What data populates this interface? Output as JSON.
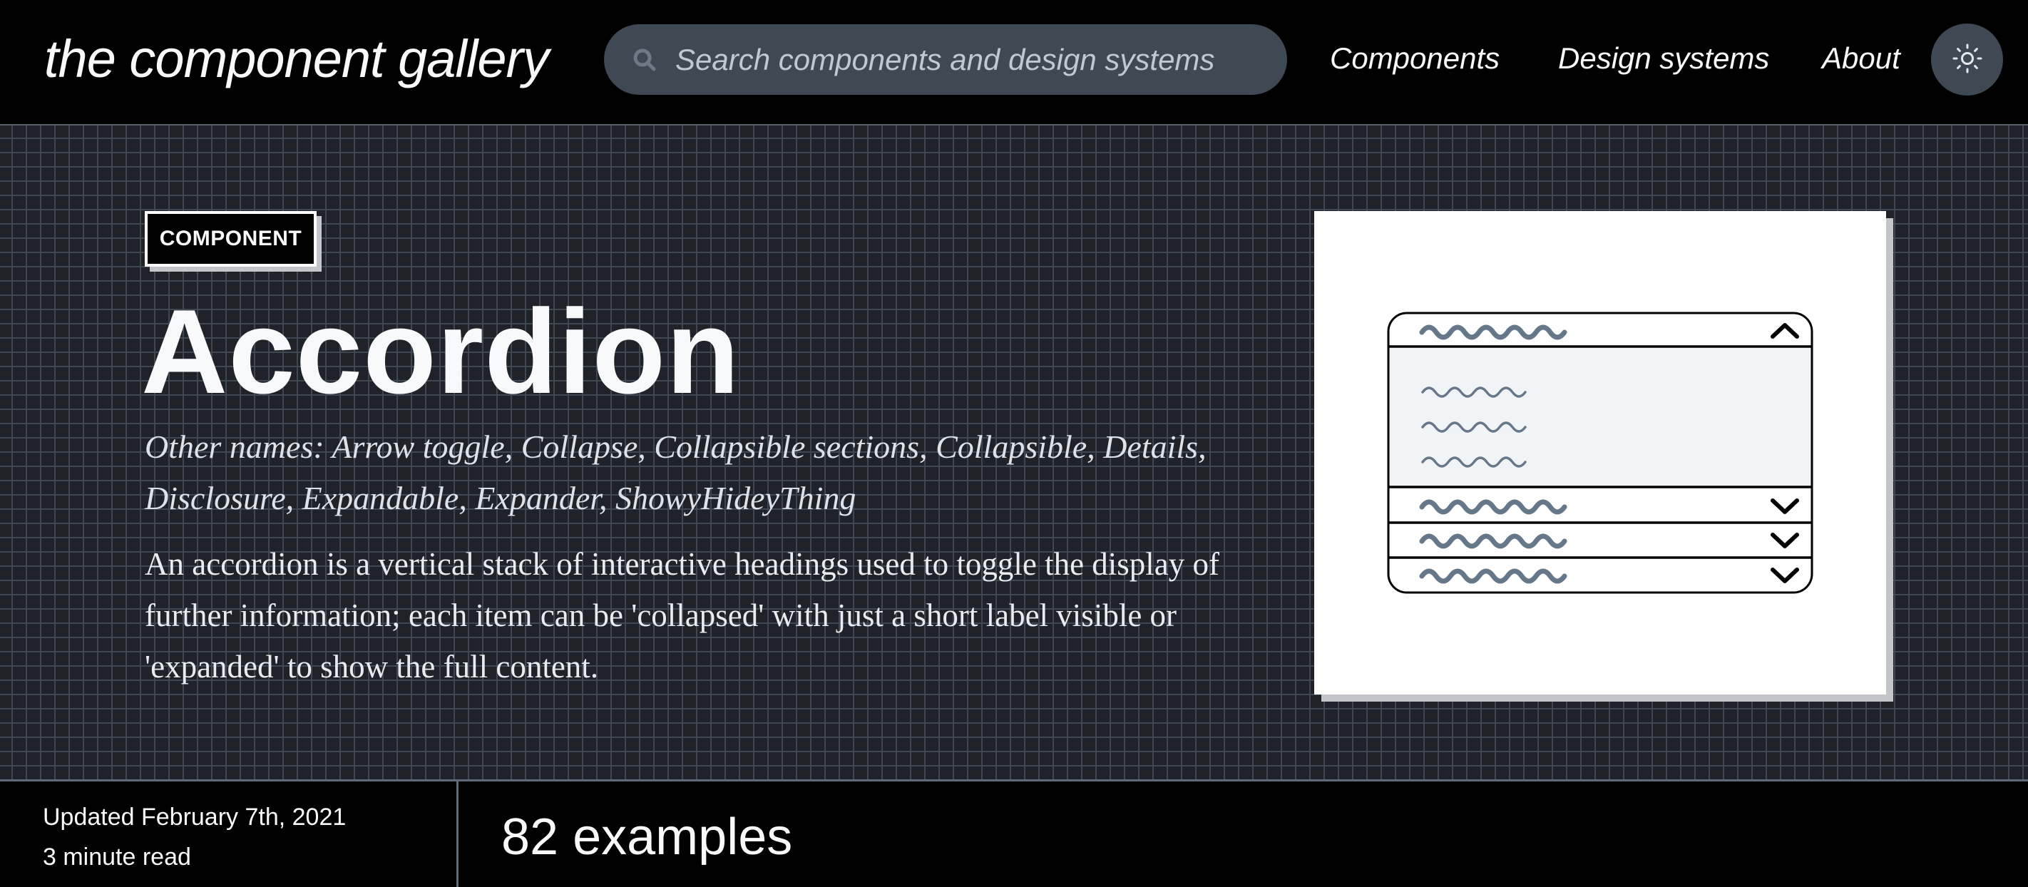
{
  "header": {
    "logo": "the component gallery",
    "search": {
      "placeholder": "Search components and design systems",
      "value": "",
      "icon": "search-icon"
    },
    "nav": [
      {
        "label": "Components"
      },
      {
        "label": "Design systems"
      },
      {
        "label": "About"
      }
    ],
    "theme_toggle": {
      "icon": "sun-icon"
    }
  },
  "hero": {
    "badge": "COMPONENT",
    "title": "Accordion",
    "other_names": "Other names: Arrow toggle, Collapse, Collapsible sections, Collapsible, Details, Disclosure, Expandable, Expander, ShowyHideyThing",
    "description": "An accordion is a vertical stack of interactive headings used to toggle the display of further information; each item can be 'collapsed' with just a short label visible or 'expanded' to show the full content.",
    "illustration": {
      "type": "accordion-diagram",
      "items": [
        {
          "state": "expanded",
          "icon": "chevron-up-icon",
          "content_lines": 3
        },
        {
          "state": "collapsed",
          "icon": "chevron-down-icon"
        },
        {
          "state": "collapsed",
          "icon": "chevron-down-icon"
        },
        {
          "state": "collapsed",
          "icon": "chevron-down-icon"
        }
      ],
      "colors": {
        "squiggle": "#67778a",
        "panel": "#f0f4f7",
        "stroke": "#000000"
      }
    }
  },
  "footer": {
    "updated": "Updated February 7th, 2021",
    "read_time": "3 minute read",
    "examples": "82 examples"
  },
  "colors": {
    "header_bg": "#000000",
    "hero_bg": "#1f2329",
    "grid_line": "#3f4852",
    "search_bg": "#3f4953",
    "text": "#f7f9fb"
  }
}
